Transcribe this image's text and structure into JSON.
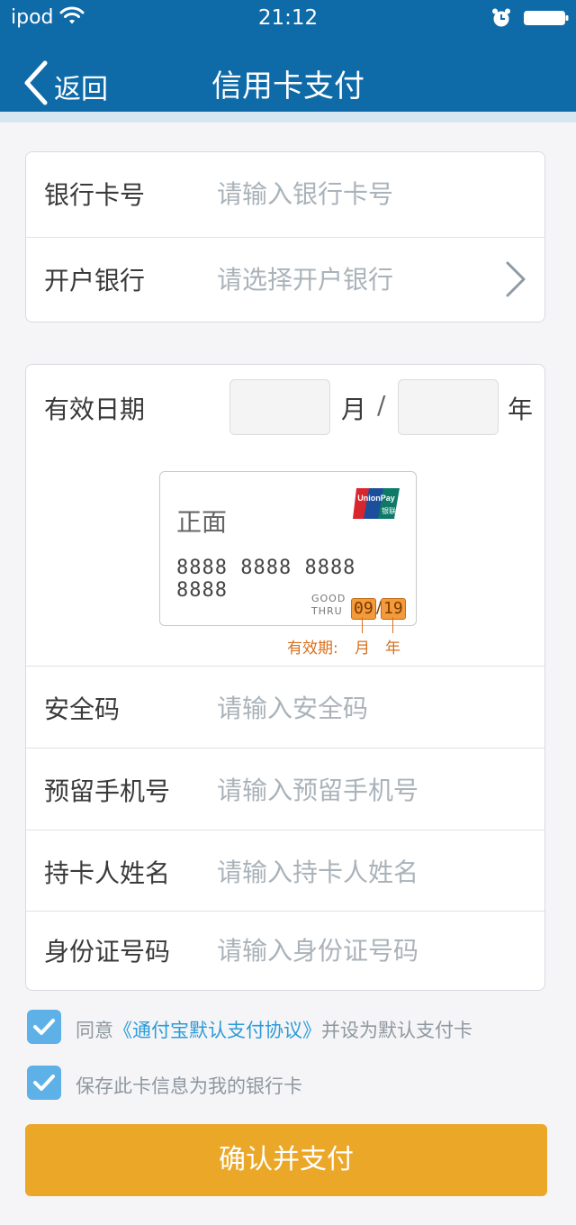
{
  "status_bar": {
    "carrier": "ipod",
    "time": "21:12"
  },
  "nav": {
    "back_label": "返回",
    "title": "信用卡支付"
  },
  "bank_section": {
    "card_number": {
      "label": "银行卡号",
      "placeholder": "请输入银行卡号"
    },
    "issuing_bank": {
      "label": "开户银行",
      "placeholder": "请选择开户银行"
    }
  },
  "expiry": {
    "label": "有效日期",
    "month_unit": "月",
    "separator": "/",
    "year_unit": "年",
    "month_value": "",
    "year_value": ""
  },
  "card_illustration": {
    "side": "正面",
    "number": "8888 8888 8888 8888",
    "good_thru_line1": "GOOD",
    "good_thru_line2": "THRU",
    "exp_month": "09",
    "exp_sep": "/",
    "exp_year": "19",
    "caption_prefix": "有效期:",
    "caption_month": "月",
    "caption_year": "年",
    "logo_text": "UnionPay",
    "logo_sub": "银联"
  },
  "details": {
    "security_code": {
      "label": "安全码",
      "placeholder": "请输入安全码"
    },
    "phone": {
      "label": "预留手机号",
      "placeholder": "请输入预留手机号"
    },
    "holder_name": {
      "label": "持卡人姓名",
      "placeholder": "请输入持卡人姓名"
    },
    "id_number": {
      "label": "身份证号码",
      "placeholder": "请输入身份证号码"
    }
  },
  "agreements": {
    "agree_prefix": "同意",
    "agree_link": "《通付宝默认支付协议》",
    "agree_suffix": "并设为默认支付卡",
    "agree_checked": true,
    "save_text": "保存此卡信息为我的银行卡",
    "save_checked": true
  },
  "submit_label": "确认并支付",
  "colors": {
    "header": "#0f6aa8",
    "accent_button": "#eba728",
    "checkbox": "#5eb1e6",
    "link": "#2d9bd8",
    "expiry_highlight": "#f39a3a"
  }
}
